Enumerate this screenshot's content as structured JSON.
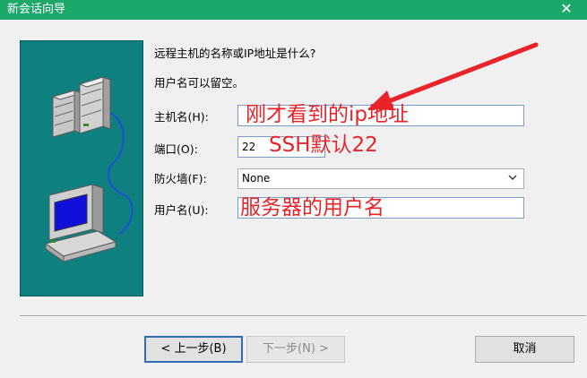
{
  "window": {
    "title": "新会话向导",
    "close_glyph": "✕"
  },
  "wizard": {
    "question": "远程主机的名称或IP地址是什么?",
    "hint": "用户名可以留空。",
    "fields": {
      "host": {
        "label": "主机名(H):",
        "value": ""
      },
      "port": {
        "label": "端口(O):",
        "value": "22"
      },
      "firewall": {
        "label": "防火墙(F):",
        "selected": "None"
      },
      "username": {
        "label": "用户名(U):",
        "value": ""
      }
    }
  },
  "annotations": {
    "host_note": "刚才看到的ip地址",
    "port_note": "SSH默认22",
    "username_note": "服务器的用户名",
    "color": "#e8242a"
  },
  "buttons": {
    "back": "< 上一步(B)",
    "next": "下一步(N) >",
    "cancel": "取消"
  },
  "colors": {
    "titlebar": "#1ca76b",
    "illustration_bg": "#0f8080",
    "primary_border": "#2f6db7"
  },
  "icons": {
    "illustration": "servers-and-computer-illustration",
    "dropdown": "chevron-down-icon",
    "close": "close-icon"
  }
}
